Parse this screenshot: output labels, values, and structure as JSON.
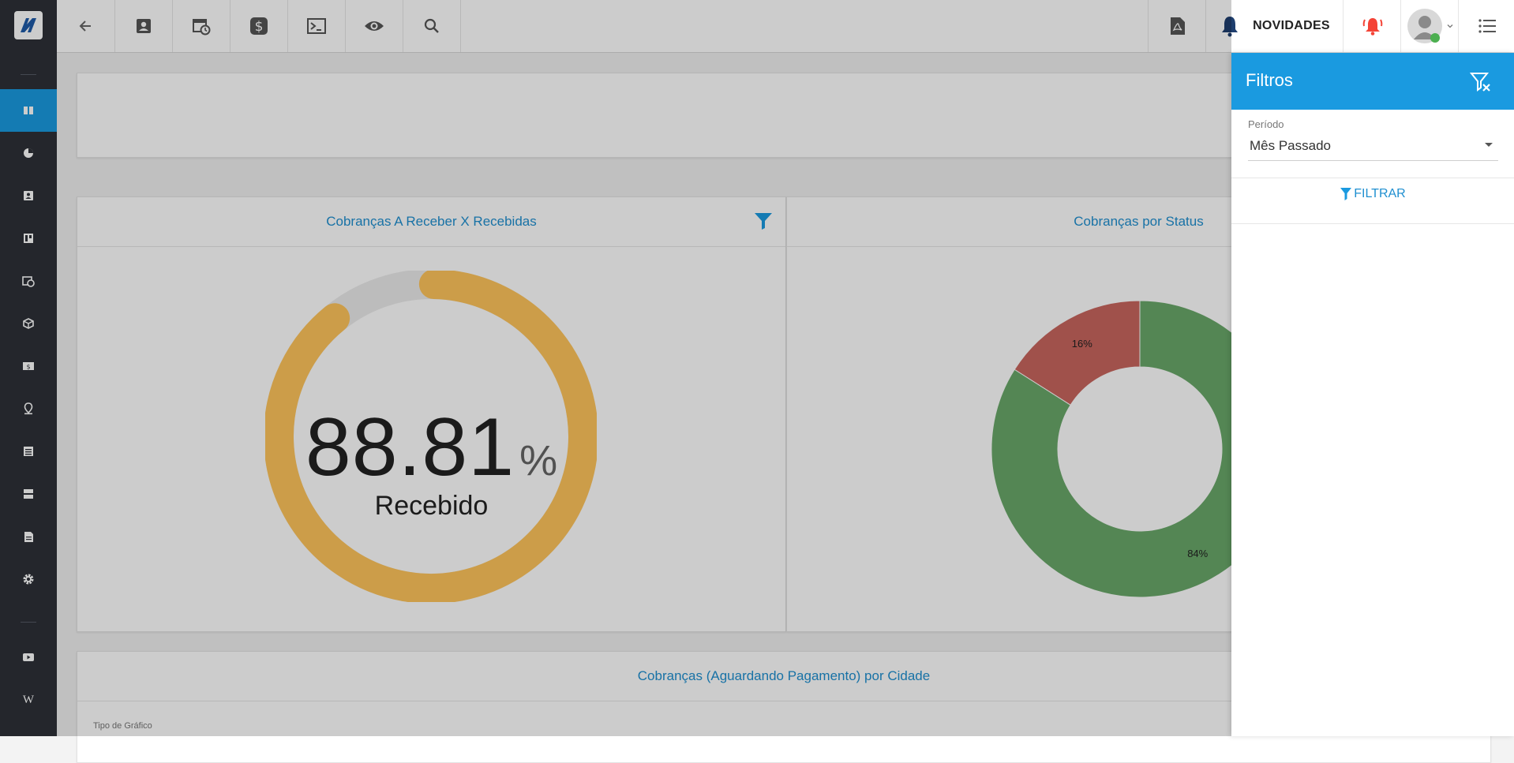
{
  "topbar": {
    "novidades_label": "NOVIDADES"
  },
  "cards": {
    "gauge_title": "Cobranças A Receber X Recebidas",
    "gauge_value": "88.81",
    "gauge_unit": "%",
    "gauge_caption": "Recebido",
    "status_title": "Cobranças por Status",
    "city_title": "Cobranças (Aguardando Pagamento) por Cidade",
    "city_chart_type_label": "Tipo de Gráfico"
  },
  "chart_data": [
    {
      "type": "gauge",
      "title": "Cobranças A Receber X Recebidas",
      "value": 88.81,
      "unit": "%",
      "caption": "Recebido",
      "range": [
        0,
        100
      ]
    },
    {
      "type": "pie",
      "title": "Cobranças por Status",
      "slices": [
        {
          "label": "84%",
          "value": 84,
          "color": "#6aa86a"
        },
        {
          "label": "16%",
          "value": 16,
          "color": "#c9665e"
        }
      ]
    }
  ],
  "filter_panel": {
    "title": "Filtros",
    "period_label": "Período",
    "period_value": "Mês Passado",
    "filter_button": "FILTRAR"
  },
  "colors": {
    "accent": "#1a9ae0",
    "sidebar": "#2d3038",
    "gauge": "#ffc55c",
    "alert": "#f44336"
  }
}
